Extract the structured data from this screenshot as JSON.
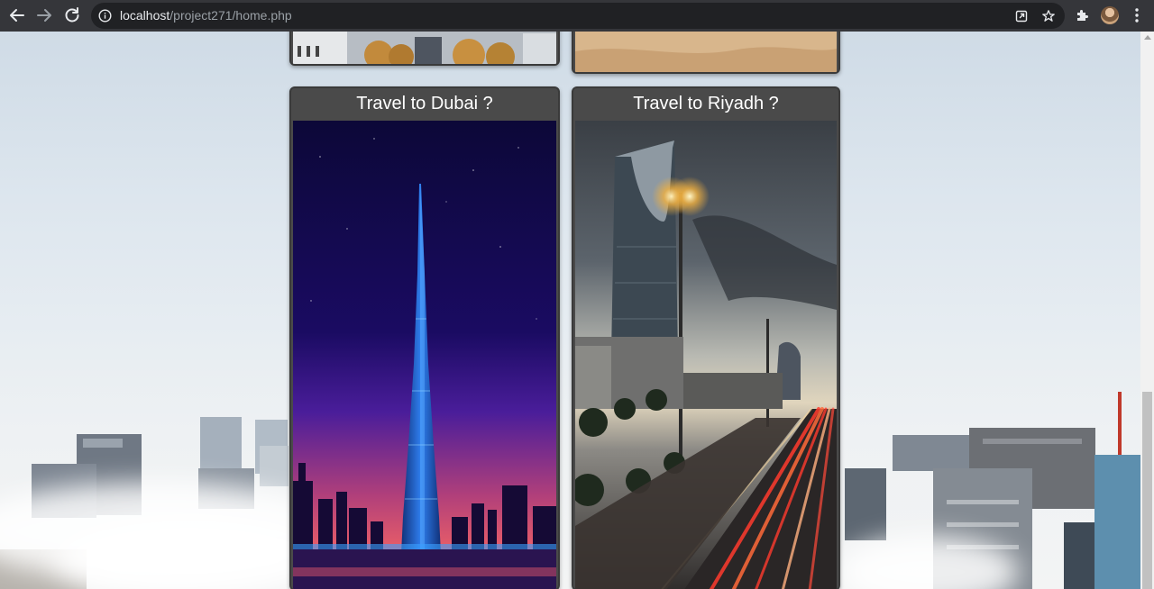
{
  "browser": {
    "url_host": "localhost",
    "url_path": "/project271/home.php",
    "icons": [
      "back-arrow-icon",
      "forward-arrow-icon",
      "reload-icon",
      "info-icon",
      "share-icon",
      "star-icon",
      "extensions-icon",
      "profile-avatar",
      "more-menu-icon"
    ]
  },
  "cards": [
    {
      "title": "Travel to Dubai ?",
      "image": "dubai-burj-khalifa-illustration"
    },
    {
      "title": "Travel to Riyadh ?",
      "image": "riyadh-kingdom-tower-photo"
    }
  ],
  "colors": {
    "chrome": "#35363a",
    "omnibox": "#202124",
    "card_header": "#4a4a4a",
    "card_title_text": "#ffffff",
    "dubai_sky_top": "#0c0838",
    "dubai_sky_bottom": "#e25a6a",
    "dubai_tower": "#1f5fc4"
  }
}
